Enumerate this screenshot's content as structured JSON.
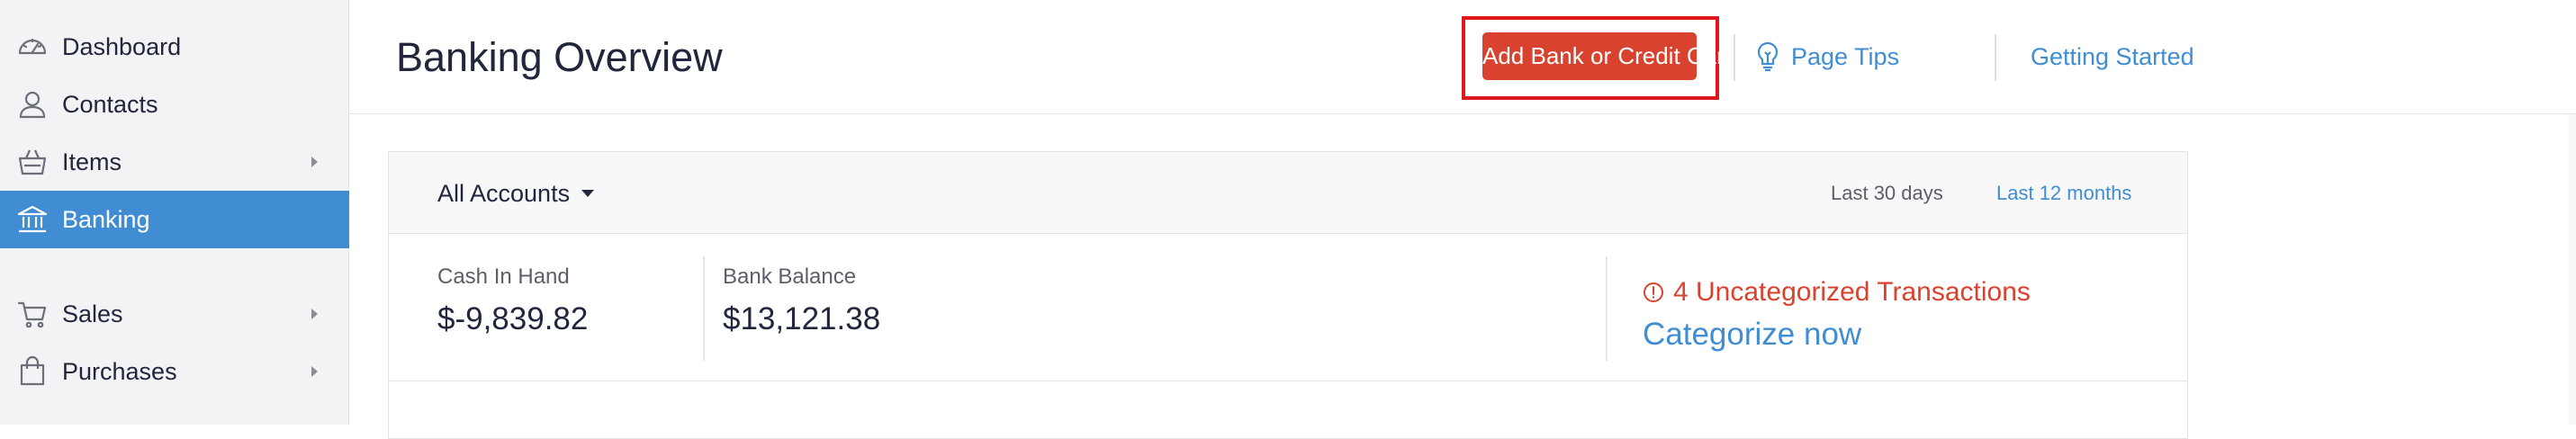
{
  "sidebar": {
    "items": [
      {
        "label": "Dashboard",
        "icon": "dashboard-gauge-icon",
        "active": false
      },
      {
        "label": "Contacts",
        "icon": "contacts-person-icon",
        "active": false
      },
      {
        "label": "Items",
        "icon": "items-basket-icon",
        "active": false,
        "has_submenu": true
      },
      {
        "label": "Banking",
        "icon": "banking-bank-icon",
        "active": true
      },
      {
        "label": "Sales",
        "icon": "sales-cart-icon",
        "active": false,
        "has_submenu": true
      },
      {
        "label": "Purchases",
        "icon": "purchases-bag-icon",
        "active": false,
        "has_submenu": true
      }
    ],
    "active_color": "#408dd3"
  },
  "header": {
    "title": "Banking Overview",
    "add_button_label": "Add Bank or Credit Card",
    "page_tips_label": "Page Tips",
    "getting_started_label": "Getting Started",
    "button_color": "#d9422e",
    "highlight_color": "#e0181e",
    "link_color": "#408dd3"
  },
  "overview": {
    "accounts_filter": "All Accounts",
    "periods": [
      {
        "label": "Last 30 days",
        "selected": true
      },
      {
        "label": "Last 12 months",
        "selected": false
      }
    ],
    "cash_in_hand": {
      "label": "Cash In Hand",
      "value": "$-9,839.82"
    },
    "bank_balance": {
      "label": "Bank Balance",
      "value": "$13,121.38"
    },
    "uncategorized_text": "4 Uncategorized Transactions",
    "categorize_link": "Categorize now",
    "alert_color": "#d9422e"
  }
}
